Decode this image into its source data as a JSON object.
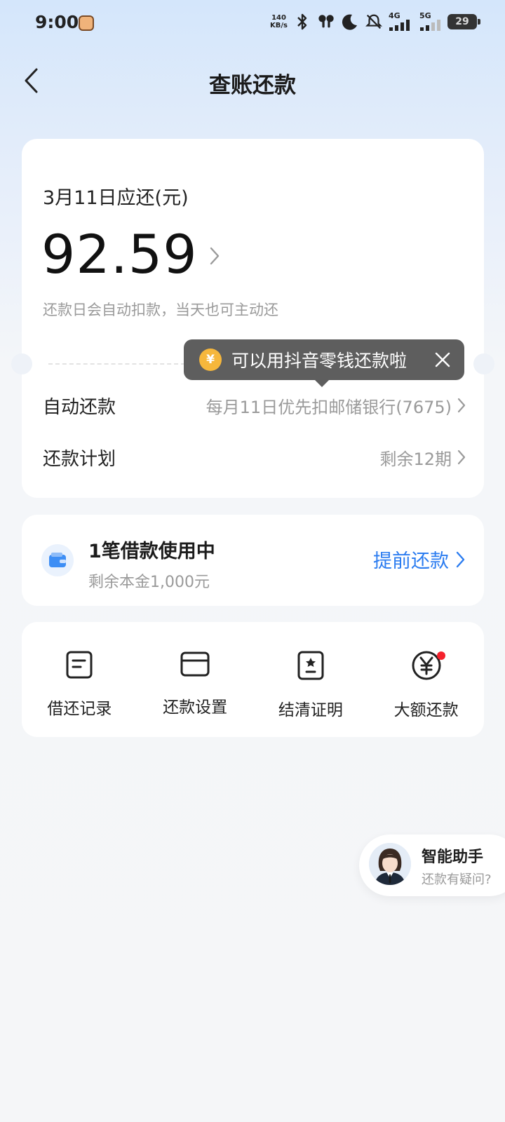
{
  "status_bar": {
    "time": "9:00",
    "net_speed_value": "140",
    "net_speed_unit": "KB/s",
    "signal_4g": "4G",
    "signal_5g": "5G",
    "battery": "29",
    "icons": [
      "bluetooth-icon",
      "earbuds-icon",
      "moon-icon",
      "mute-icon",
      "signal-4g-icon",
      "signal-5g-icon",
      "battery-icon"
    ]
  },
  "header": {
    "title": "查账还款"
  },
  "bill": {
    "due_label": "3月11日应还(元)",
    "amount": "92.59",
    "hint": "还款日会自动扣款，当天也可主动还"
  },
  "tooltip": {
    "coin_symbol": "¥",
    "text": "可以用抖音零钱还款啦"
  },
  "rows": {
    "auto_label": "自动还款",
    "auto_value": "每月11日优先扣邮储银行(7675)",
    "plan_label": "还款计划",
    "plan_value": "剩余12期"
  },
  "loan": {
    "title": "1笔借款使用中",
    "remaining": "剩余本金1,000元",
    "prepay_label": "提前还款"
  },
  "tools": [
    {
      "label": "借还记录",
      "icon": "document-icon"
    },
    {
      "label": "还款设置",
      "icon": "card-icon"
    },
    {
      "label": "结清证明",
      "icon": "certificate-icon"
    },
    {
      "label": "大额还款",
      "icon": "yuan-circle-icon"
    }
  ],
  "assistant": {
    "title": "智能助手",
    "subtitle": "还款有疑问?"
  },
  "colors": {
    "accent": "#2b7cf0",
    "tooltip_bg": "#5e5e5e",
    "coin": "#f6b73c",
    "badge_red": "#f5222d"
  }
}
